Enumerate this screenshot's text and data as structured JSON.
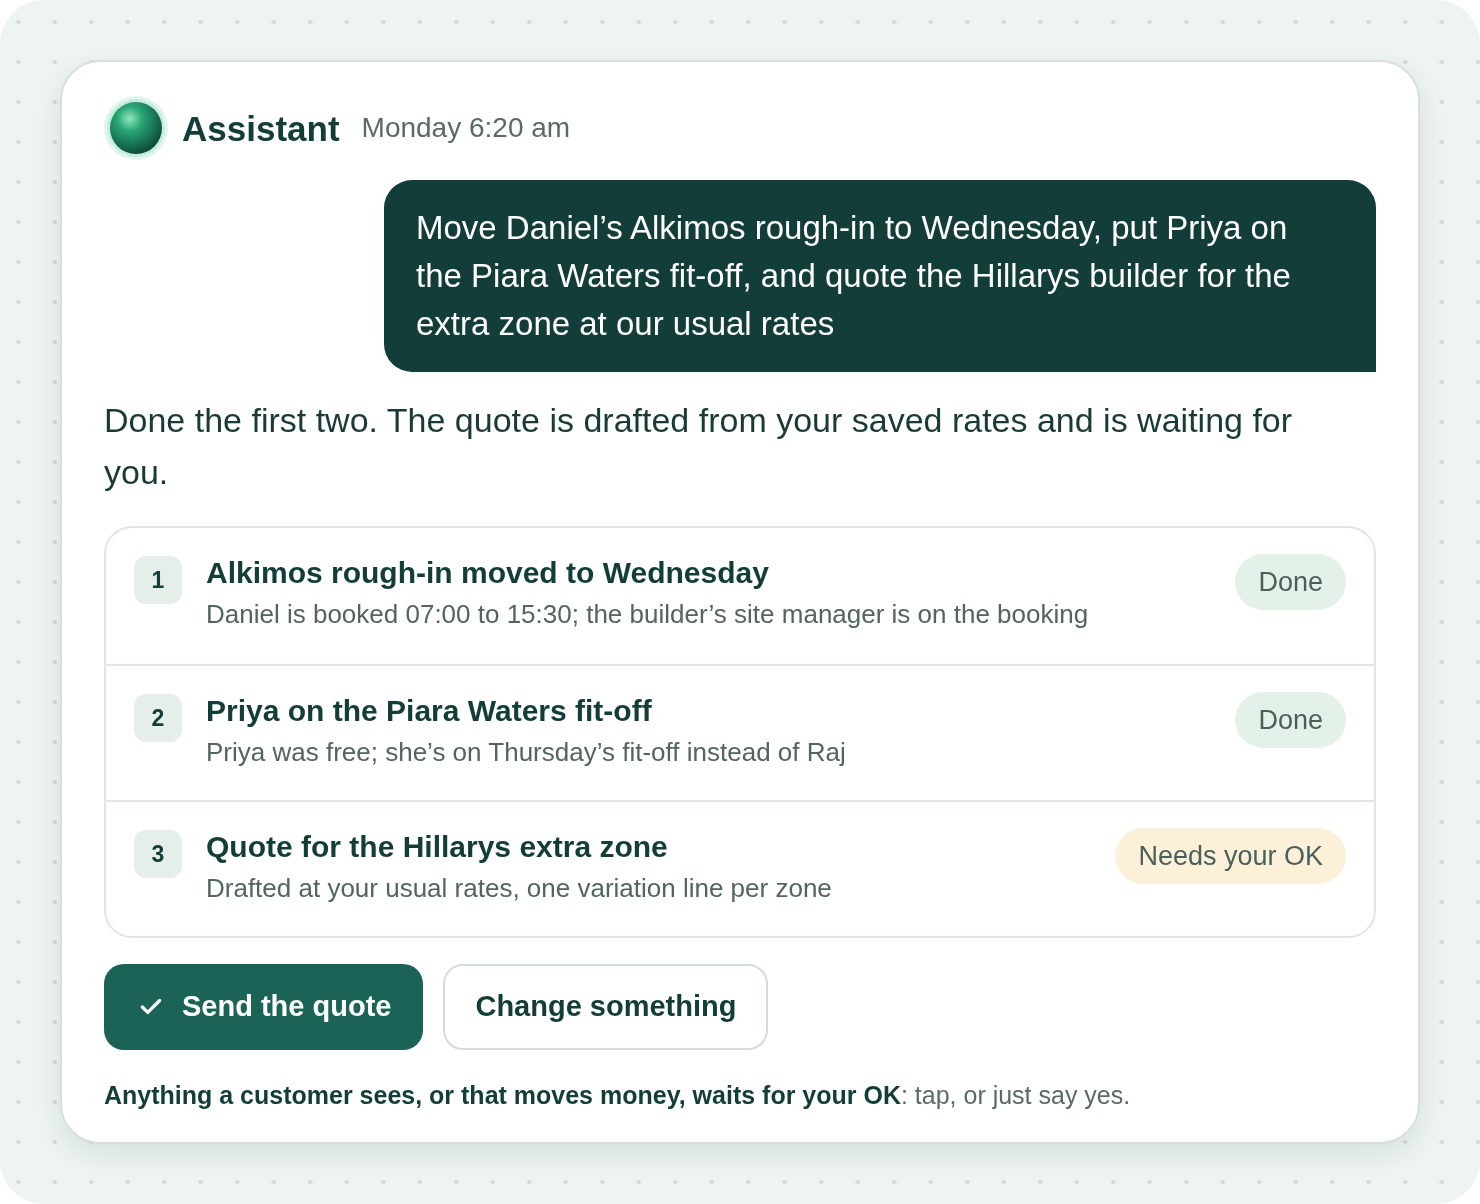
{
  "header": {
    "sender": "Assistant",
    "timestamp": "Monday 6:20 am"
  },
  "user_message": {
    "text": "Move Daniel’s Alkimos rough-in to Wednesday, put Priya on the Piara Waters fit-off, and quote the Hillarys builder for the extra zone at our usual rates"
  },
  "reply": {
    "text": "Done the first two. The quote is drafted from your saved rates and is waiting for you."
  },
  "steps": [
    {
      "number": "1",
      "title": "Alkimos rough-in moved to Wednesday",
      "detail": "Daniel is booked 07:00 to 15:30; the builder’s site manager is on the booking",
      "status": {
        "label": "Done",
        "kind": "done"
      }
    },
    {
      "number": "2",
      "title": "Priya on the Piara Waters fit-off",
      "detail": "Priya was free; she’s on Thursday’s fit-off instead of Raj",
      "status": {
        "label": "Done",
        "kind": "done"
      }
    },
    {
      "number": "3",
      "title": "Quote for the Hillarys extra zone",
      "detail": "Drafted at your usual rates, one variation line per zone",
      "status": {
        "label": "Needs your OK",
        "kind": "needs_ok"
      }
    }
  ],
  "actions": [
    {
      "label": "Send the quote",
      "kind": "primary"
    },
    {
      "label": "Change something",
      "kind": "secondary"
    }
  ],
  "footnote": "**Anything a customer sees, or that moves money, waits for your OK**: tap, or just say yes."
}
